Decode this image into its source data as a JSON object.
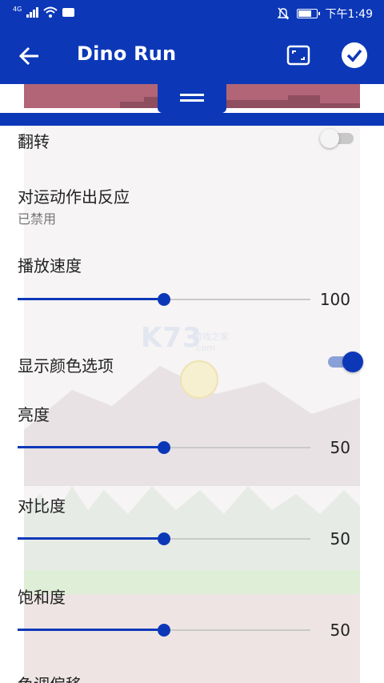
{
  "status_bar": {
    "network_label": "4G",
    "time": "下午1:49",
    "icons": [
      "signal-icon",
      "wifi-icon",
      "mail-icon",
      "mute-icon",
      "battery-icon"
    ]
  },
  "app_bar": {
    "title": "Dino Run",
    "icons": {
      "back": "arrow-left-icon",
      "fit": "fit-screen-icon",
      "confirm": "check-circle-icon"
    }
  },
  "watermark": {
    "brand": "K73",
    "text": "游戏之家",
    "domain": ".com"
  },
  "settings": {
    "flip": {
      "label": "翻转",
      "on": false
    },
    "motion": {
      "label": "对运动作出反应",
      "status": "已禁用"
    },
    "speed": {
      "label": "播放速度",
      "value": "100",
      "level": 0.5
    },
    "color_options": {
      "label": "显示颜色选项",
      "on": true
    },
    "brightness": {
      "label": "亮度",
      "value": "50",
      "level": 0.5
    },
    "contrast": {
      "label": "对比度",
      "value": "50",
      "level": 0.5
    },
    "saturation": {
      "label": "饱和度",
      "value": "50",
      "level": 0.5
    },
    "hue": {
      "label": "色调偏移"
    }
  },
  "colors": {
    "accent": "#0c38b8",
    "preview": "#b26577",
    "track_off": "#c9c9c9"
  }
}
